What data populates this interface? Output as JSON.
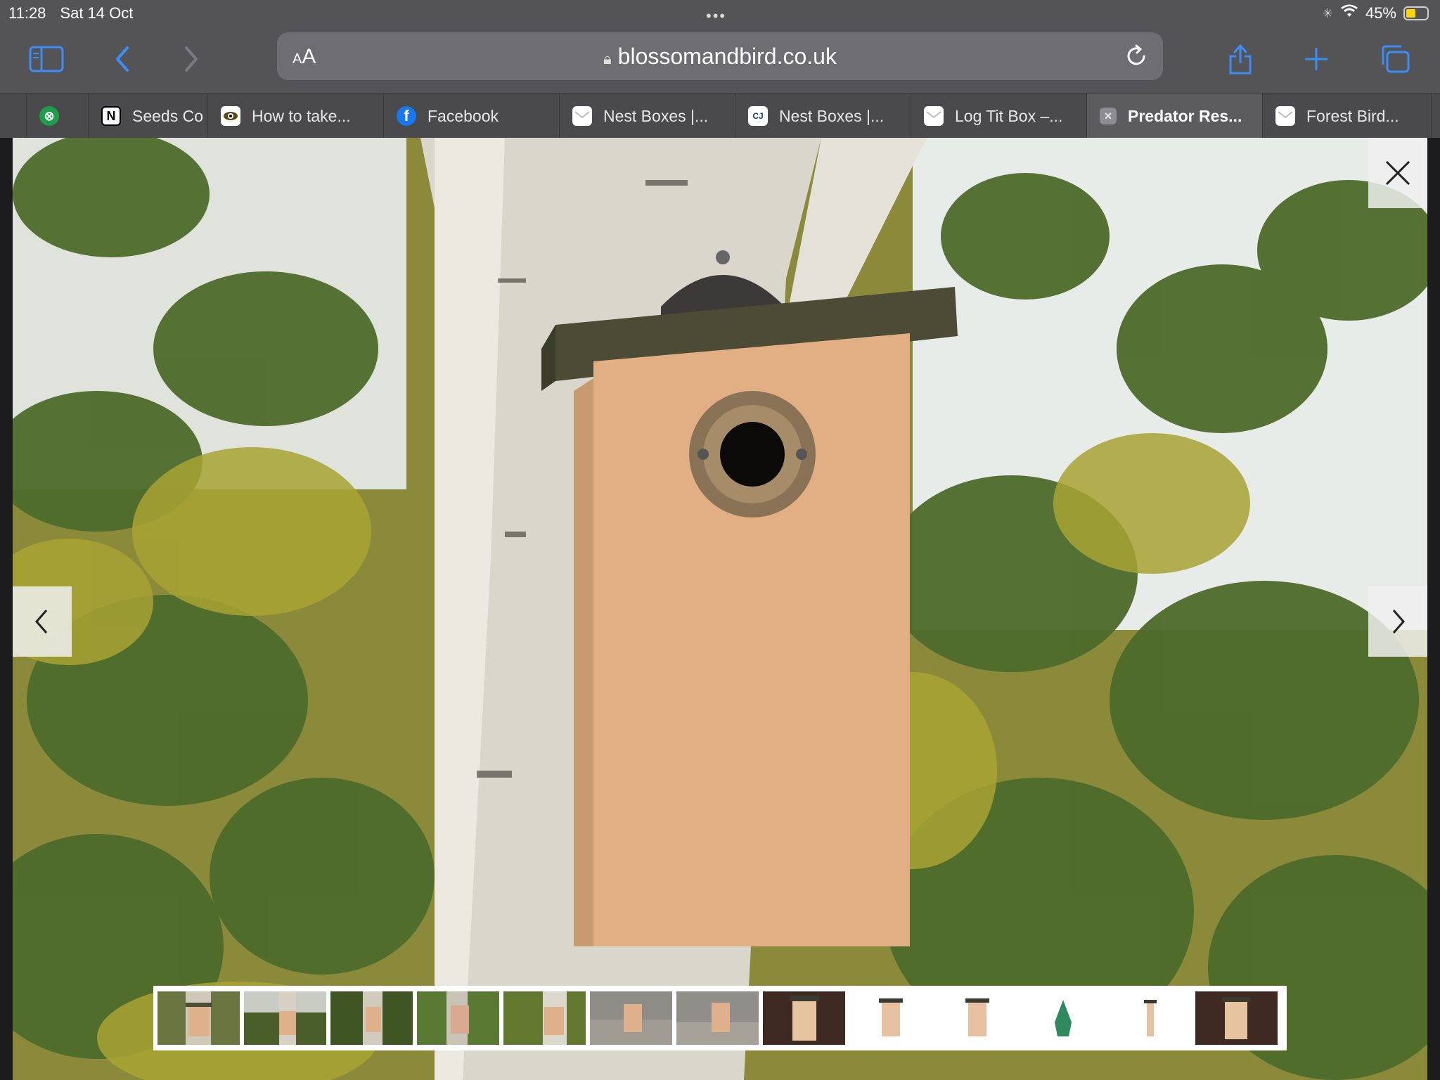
{
  "status_bar": {
    "time": "11:28",
    "date": "Sat 14 Oct",
    "battery": "45%",
    "battery_level": 0.45
  },
  "toolbar": {
    "text_size_small": "A",
    "text_size_large": "A",
    "url": "blossomandbird.co.uk"
  },
  "tabs": [
    {
      "label": "",
      "favicon": "divider"
    },
    {
      "label": "",
      "favicon": "green-circle-icon"
    },
    {
      "label": "Seeds Co",
      "favicon": "N"
    },
    {
      "label": "How to take...",
      "favicon": "eye-icon"
    },
    {
      "label": "Facebook",
      "favicon": "facebook-icon"
    },
    {
      "label": "Nest Boxes |...",
      "favicon": "envelope-icon"
    },
    {
      "label": "Nest Boxes |...",
      "favicon": "wildlife-icon"
    },
    {
      "label": "Log Tit Box –...",
      "favicon": "envelope-icon"
    },
    {
      "label": "Predator Res...",
      "favicon": "close-icon",
      "active": true
    },
    {
      "label": "Forest Bird...",
      "favicon": "envelope-icon"
    }
  ],
  "gallery": {
    "thumbnail_count": 13,
    "selected_index": 7
  },
  "colors": {
    "accent": "#0a84ff",
    "chrome": "#545456"
  }
}
